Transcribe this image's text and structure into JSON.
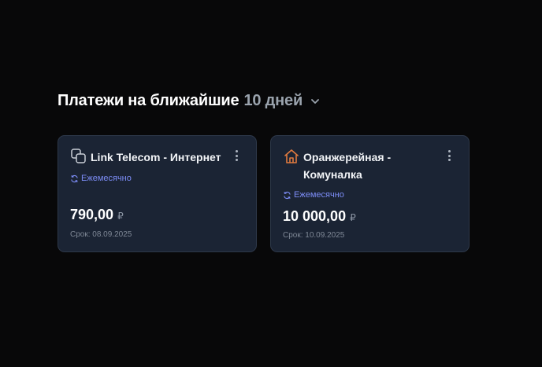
{
  "section": {
    "title": "Платежи на ближайшие",
    "range_label": "10 дней"
  },
  "payments": [
    {
      "title": "Link Telecom - Интернет",
      "icon": "layers-icon",
      "frequency": "Ежемесячно",
      "amount": "790,00",
      "currency": "₽",
      "due": "Срок: 08.09.2025"
    },
    {
      "title": "Оранжерейная - Комуналка",
      "icon": "house-icon",
      "frequency": "Ежемесячно",
      "amount": "10 000,00",
      "currency": "₽",
      "due": "Срок: 10.09.2025"
    }
  ],
  "colors": {
    "background": "#080809",
    "card": "#1b2434",
    "accent_frequency": "#7c8cf5",
    "house_icon": "#e07a3f",
    "muted": "#9aa3ad"
  }
}
